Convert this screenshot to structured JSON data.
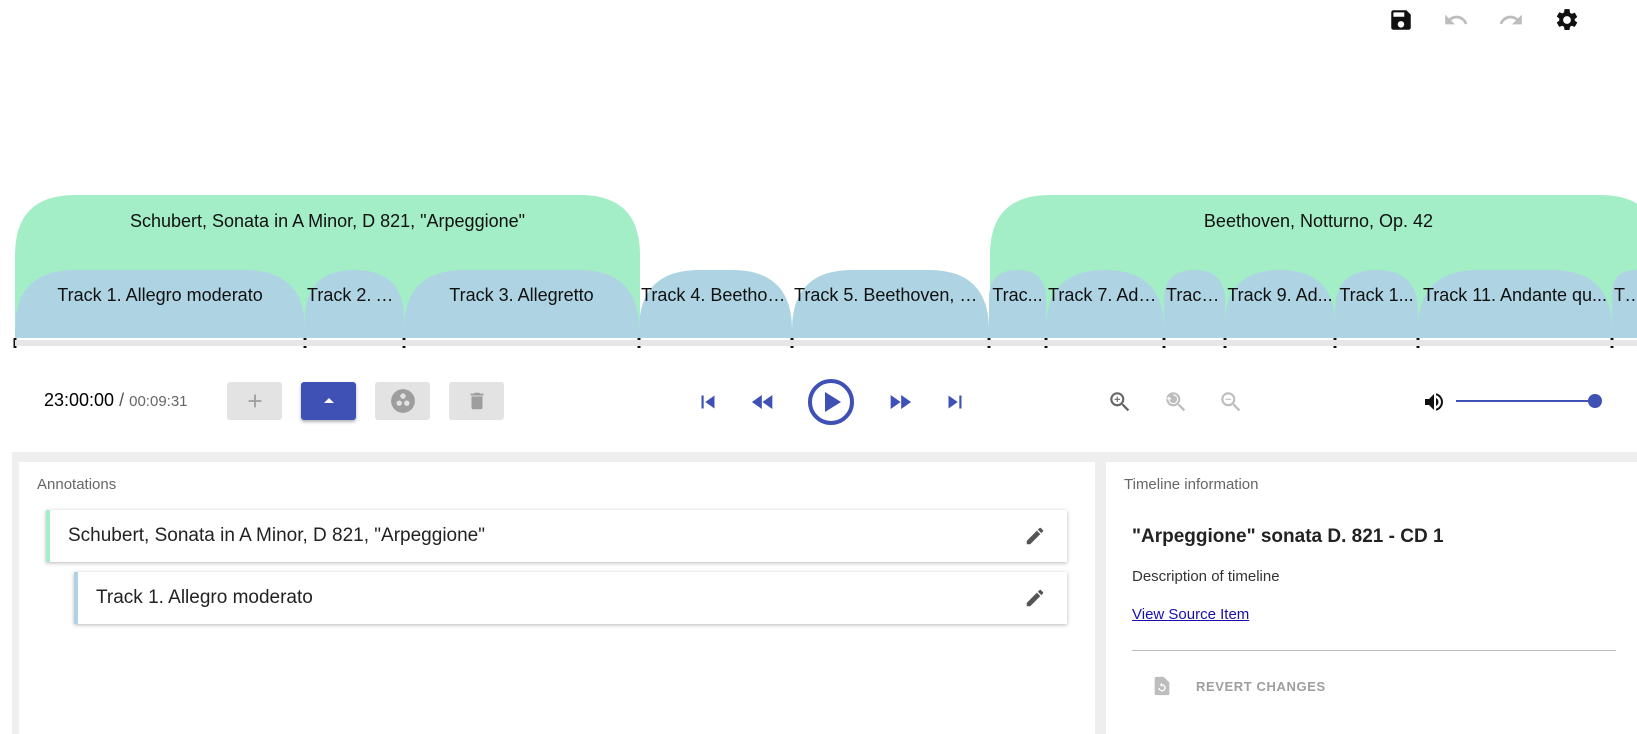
{
  "toolbar": {
    "save_icon": "save-icon",
    "undo_icon": "undo-icon",
    "redo_icon": "redo-icon",
    "settings_icon": "gear-icon"
  },
  "timeline": {
    "groups": [
      {
        "label": "Schubert, Sonata in A Minor, D 821, \"Arpeggione\""
      },
      {
        "label": "Beethoven, Notturno, Op. 42"
      }
    ],
    "tracks": [
      {
        "label": "Track 1. Allegro moderato"
      },
      {
        "label": "Track 2. A..."
      },
      {
        "label": "Track 3. Allegretto"
      },
      {
        "label": "Track 4. Beethov..."
      },
      {
        "label": "Track 5. Beethoven, R..."
      },
      {
        "label": "Trac..."
      },
      {
        "label": "Track 7. Ada..."
      },
      {
        "label": "Track..."
      },
      {
        "label": "Track 9. Ad..."
      },
      {
        "label": "Track 1..."
      },
      {
        "label": "Track 11. Andante qu..."
      },
      {
        "label": "Tr..."
      }
    ],
    "colors": {
      "group": "#a3edc7",
      "track": "#aed4e4",
      "tick": "#111111",
      "axis": "#e6e6e6"
    }
  },
  "controls": {
    "current_time": "23:00:00",
    "separator": "/",
    "total_time": "00:09:31",
    "add_icon": "plus-icon",
    "collapse_icon": "caret-up-icon",
    "group_icon": "circles-icon",
    "delete_icon": "trash-icon",
    "skip_back_icon": "skip-previous-icon",
    "rewind_icon": "rewind-icon",
    "play_icon": "play-circle-icon",
    "fast_forward_icon": "fast-forward-icon",
    "skip_next_icon": "skip-next-icon",
    "zoom_in_icon": "zoom-in-icon",
    "zoom_reset_icon": "zoom-reset-icon",
    "zoom_out_icon": "zoom-out-icon",
    "volume_icon": "volume-icon",
    "volume_level": 1.0,
    "accent": "#3f51b5"
  },
  "annotations": {
    "title": "Annotations",
    "items": [
      {
        "label": "Schubert, Sonata in A Minor, D 821, \"Arpeggione\"",
        "color": "#a3edc7"
      },
      {
        "label": "Track 1. Allegro moderato",
        "color": "#aed4e4"
      }
    ]
  },
  "timeline_info": {
    "title": "Timeline information",
    "name": "\"Arpeggione\" sonata D. 821 - CD 1",
    "description": "Description of timeline",
    "link_text": "View Source Item",
    "revert_label": "REVERT CHANGES",
    "revert_icon": "revert-icon"
  }
}
